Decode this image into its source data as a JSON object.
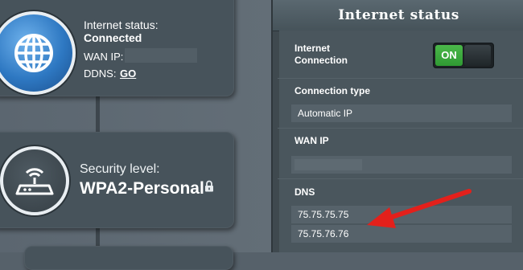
{
  "status_card": {
    "internet_status_label": "Internet status:",
    "internet_status_value": "Connected",
    "wan_ip_label": "WAN IP:",
    "ddns_label": "DDNS:",
    "ddns_link": "GO"
  },
  "security_card": {
    "security_level_label": "Security level:",
    "security_level_value": "WPA2-Personal"
  },
  "panel": {
    "title": "Internet status",
    "internet_connection_label_1": "Internet",
    "internet_connection_label_2": "Connection",
    "toggle_label": "ON",
    "connection_type_label": "Connection type",
    "connection_type_value": "Automatic IP",
    "wan_ip_label": "WAN IP",
    "dns_label": "DNS",
    "dns_primary": "75.75.75.75",
    "dns_secondary": "75.75.76.76"
  },
  "colors": {
    "toggle_on": "#3aa83c",
    "annotation_arrow": "#e3201b",
    "globe_blue": "#2e78c2"
  },
  "icons": [
    "globe-icon",
    "router-icon",
    "lock-icon",
    "annotation-arrow"
  ]
}
